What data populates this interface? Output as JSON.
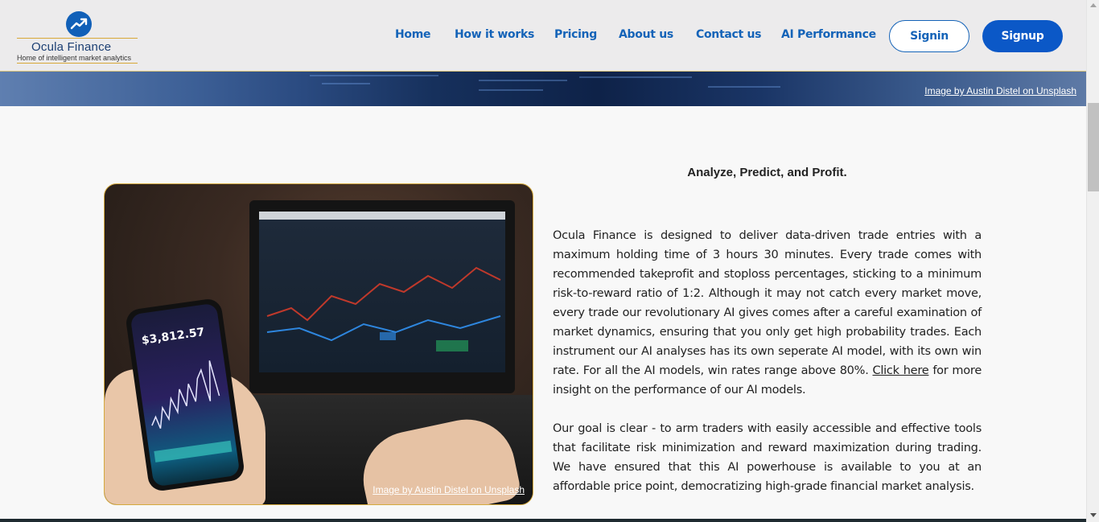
{
  "brand": {
    "name": "Ocula Finance",
    "tagline": "Home of intelligent market analytics",
    "accent": "#1463b8",
    "gold": "#d4a93e"
  },
  "nav": {
    "items": [
      "Home",
      "How it works",
      "Pricing",
      "About us",
      "Contact us",
      "AI Performance"
    ],
    "signin": "Signin",
    "signup": "Signup"
  },
  "hero": {
    "credit": "Image by Austin Distel on Unsplash"
  },
  "about": {
    "heading": "Analyze, Predict, and Profit.",
    "para1_before": "Ocula Finance is designed to deliver data-driven trade entries with a maximum holding time of 3 hours 30 minutes. Every trade comes with recommended takeprofit and stoploss percentages, sticking to a minimum risk-to-reward ratio of 1:2. Although it may not catch every market move, every trade our revolutionary AI gives comes after a careful examination of market dynamics, ensuring that you only get high probability trades. Each instrument our AI analyses has its own seperate AI model, with its own win rate. For all the AI models, win rates range above 80%. ",
    "para1_link": "Click here",
    "para1_after": " for more insight on the performance of our AI models.",
    "para2": "Our goal is clear - to arm traders with easily accessible and effective tools that facilitate risk minimization and reward maximization during trading. We have ensured that this AI powerhouse is available to you at an affordable price point, democratizing high-grade financial market analysis.",
    "image_credit": "Image by Austin Distel on Unsplash",
    "phone_price": "$3,812.57"
  }
}
